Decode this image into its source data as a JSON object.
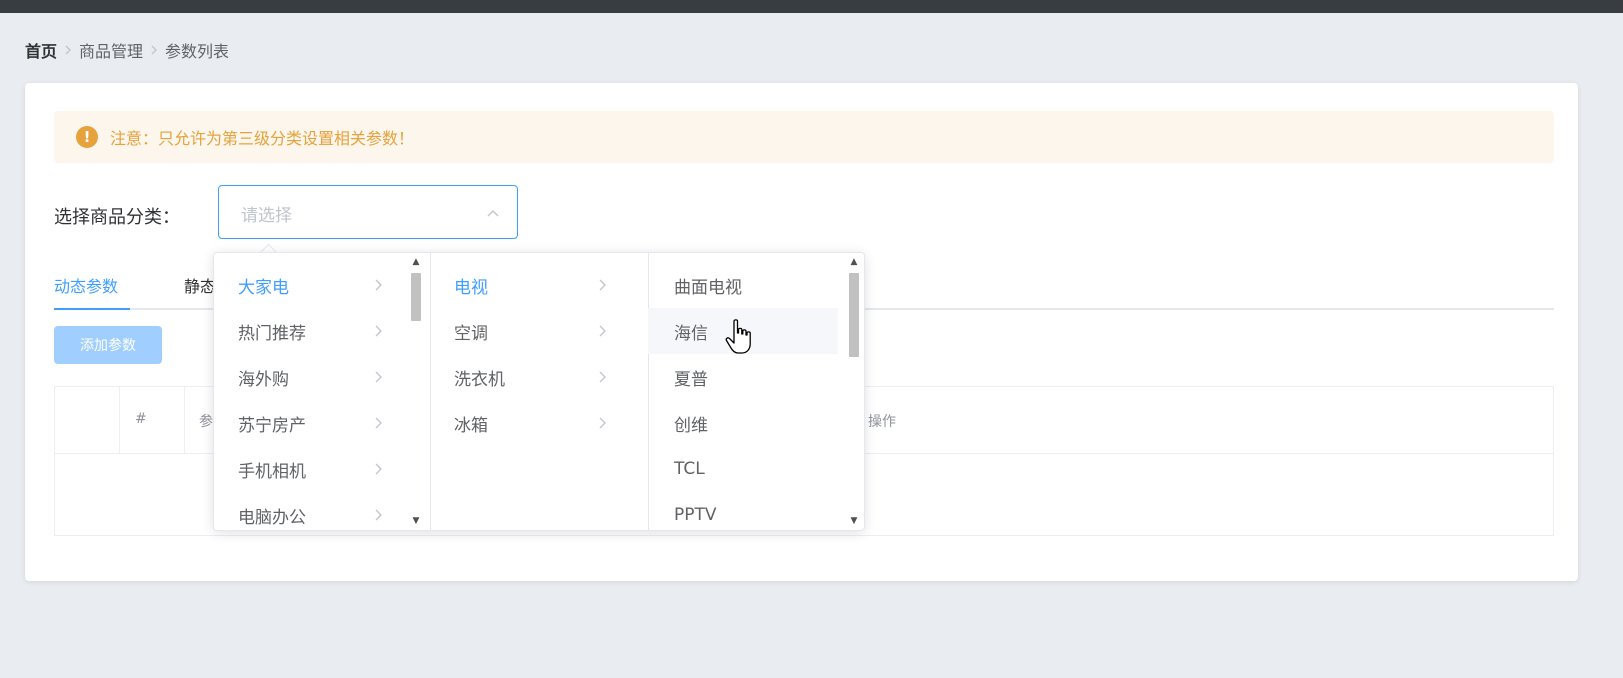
{
  "breadcrumb": {
    "home": "首页",
    "level1": "商品管理",
    "level2": "参数列表"
  },
  "alert": {
    "text": "注意：只允许为第三级分类设置相关参数！",
    "icon": "warning-circle-icon",
    "color": "#e6a23c"
  },
  "category_select": {
    "label": "选择商品分类：",
    "placeholder": "请选择",
    "arrow_icon": "chevron-up-icon"
  },
  "tabs": [
    {
      "label": "动态参数",
      "active": true
    },
    {
      "label": "静态属性",
      "active": false
    }
  ],
  "add_button": {
    "label": "添加参数"
  },
  "table": {
    "columns": [
      "",
      "#",
      "参数名称",
      "操作"
    ]
  },
  "cascader": {
    "level1": [
      "大家电",
      "热门推荐",
      "海外购",
      "苏宁房产",
      "手机相机",
      "电脑办公"
    ],
    "level1_active": "大家电",
    "level2": [
      "电视",
      "空调",
      "洗衣机",
      "冰箱"
    ],
    "level2_active": "电视",
    "level3": [
      "曲面电视",
      "海信",
      "夏普",
      "创维",
      "TCL",
      "PPTV"
    ],
    "level3_hover": "海信"
  },
  "colors": {
    "primary": "#409eff",
    "warning": "#e6a23c",
    "topbar": "#373d41"
  }
}
